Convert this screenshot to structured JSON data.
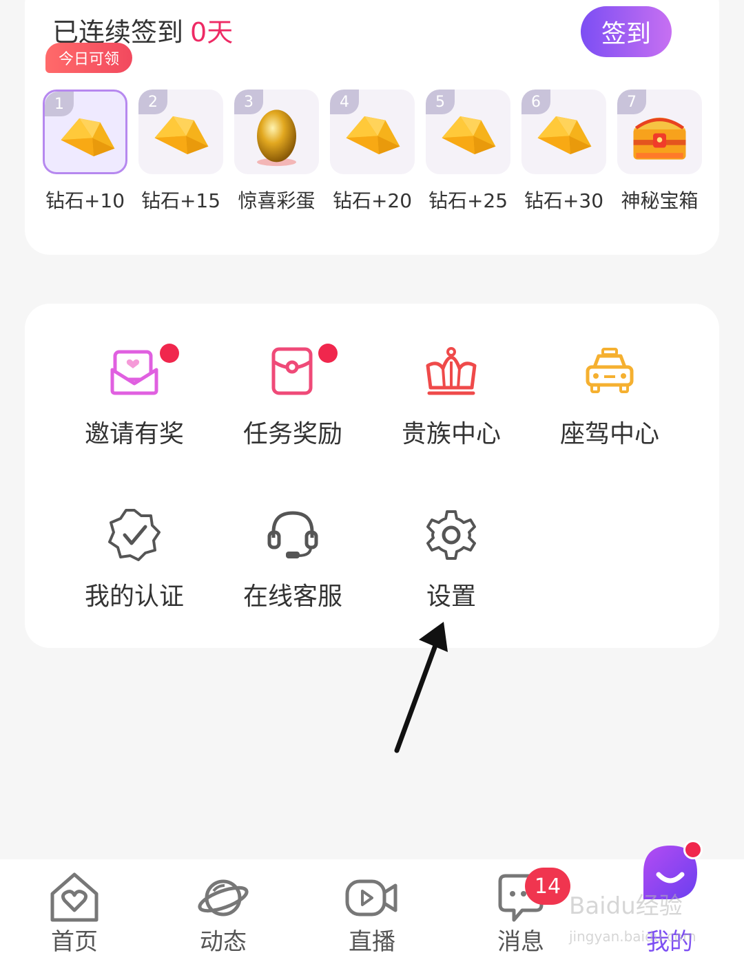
{
  "signin": {
    "streak_prefix": "已连续签到",
    "streak_days": "0天",
    "button_label": "签到",
    "today_badge": "今日可领",
    "days": [
      {
        "num": "1",
        "label": "钻石+10",
        "reward": "diamond-icon"
      },
      {
        "num": "2",
        "label": "钻石+15",
        "reward": "diamond-icon"
      },
      {
        "num": "3",
        "label": "惊喜彩蛋",
        "reward": "golden-egg-icon"
      },
      {
        "num": "4",
        "label": "钻石+20",
        "reward": "diamond-icon"
      },
      {
        "num": "5",
        "label": "钻石+25",
        "reward": "diamond-icon"
      },
      {
        "num": "6",
        "label": "钻石+30",
        "reward": "diamond-icon"
      },
      {
        "num": "7",
        "label": "神秘宝箱",
        "reward": "treasure-chest-icon"
      }
    ]
  },
  "features": [
    {
      "label": "邀请有奖",
      "icon": "invite-envelope-icon",
      "has_dot": true
    },
    {
      "label": "任务奖励",
      "icon": "task-reward-icon",
      "has_dot": true
    },
    {
      "label": "贵族中心",
      "icon": "crown-icon",
      "has_dot": false
    },
    {
      "label": "座驾中心",
      "icon": "car-icon",
      "has_dot": false
    },
    {
      "label": "我的认证",
      "icon": "verified-badge-icon",
      "has_dot": false
    },
    {
      "label": "在线客服",
      "icon": "headset-icon",
      "has_dot": false
    },
    {
      "label": "设置",
      "icon": "gear-icon",
      "has_dot": false
    }
  ],
  "tabbar": {
    "tabs": [
      {
        "label": "首页",
        "icon": "home-heart-icon",
        "active": false
      },
      {
        "label": "动态",
        "icon": "planet-icon",
        "active": false
      },
      {
        "label": "直播",
        "icon": "video-camera-icon",
        "active": false
      },
      {
        "label": "消息",
        "icon": "chat-bubble-icon",
        "active": false
      },
      {
        "label": "我的",
        "icon": "smiley-avatar-icon",
        "active": true
      }
    ],
    "message_badge": "14"
  },
  "watermark": {
    "line1": "Baidu经验",
    "line2": "jingyan.baidu.com"
  },
  "colors": {
    "accent_purple": "#7c4ef3",
    "streak_red": "#ee2a64",
    "notification_red": "#f0274d",
    "invite_pink": "#e060e0",
    "task_pink": "#ef4a78",
    "crown_red": "#ef4a4a",
    "car_orange": "#f5b030"
  }
}
